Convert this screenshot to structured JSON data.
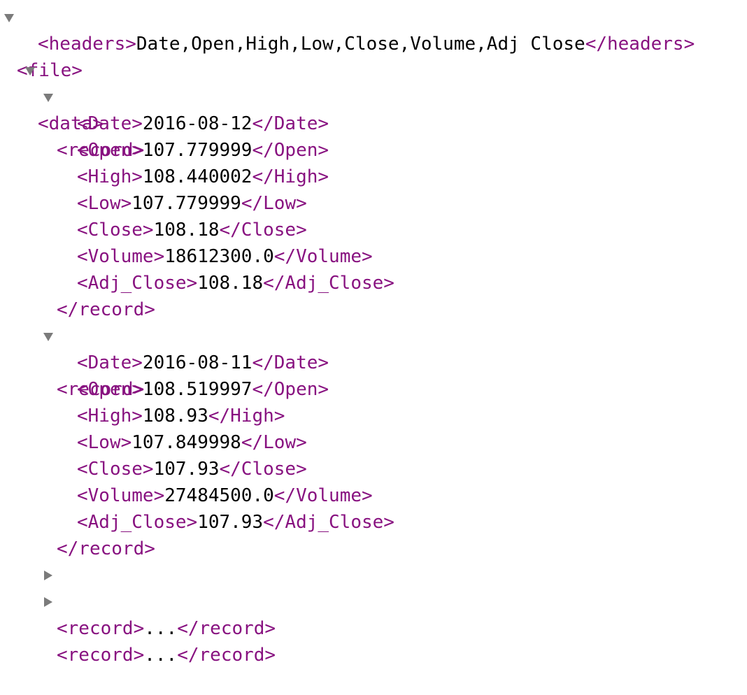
{
  "file": {
    "open_tag": "<file>",
    "headers": {
      "open_tag": "<headers>",
      "value": "Date,Open,High,Low,Close,Volume,Adj Close",
      "close_tag": "</headers>"
    },
    "data": {
      "open_tag": "<data>",
      "records": [
        {
          "open_tag": "<record>",
          "close_tag": "</record>",
          "fields": [
            {
              "open": "<Date>",
              "value": "2016-08-12",
              "close": "</Date>"
            },
            {
              "open": "<Open>",
              "value": "107.779999",
              "close": "</Open>"
            },
            {
              "open": "<High>",
              "value": "108.440002",
              "close": "</High>"
            },
            {
              "open": "<Low>",
              "value": "107.779999",
              "close": "</Low>"
            },
            {
              "open": "<Close>",
              "value": "108.18",
              "close": "</Close>"
            },
            {
              "open": "<Volume>",
              "value": "18612300.0",
              "close": "</Volume>"
            },
            {
              "open": "<Adj_Close>",
              "value": "108.18",
              "close": "</Adj_Close>"
            }
          ]
        },
        {
          "open_tag": "<record>",
          "close_tag": "</record>",
          "fields": [
            {
              "open": "<Date>",
              "value": "2016-08-11",
              "close": "</Date>"
            },
            {
              "open": "<Open>",
              "value": "108.519997",
              "close": "</Open>"
            },
            {
              "open": "<High>",
              "value": "108.93",
              "close": "</High>"
            },
            {
              "open": "<Low>",
              "value": "107.849998",
              "close": "</Low>"
            },
            {
              "open": "<Close>",
              "value": "107.93",
              "close": "</Close>"
            },
            {
              "open": "<Volume>",
              "value": "27484500.0",
              "close": "</Volume>"
            },
            {
              "open": "<Adj_Close>",
              "value": "107.93",
              "close": "</Adj_Close>"
            }
          ]
        }
      ],
      "collapsed_records": [
        {
          "open_tag": "<record>",
          "ellipsis": "...",
          "close_tag": "</record>"
        },
        {
          "open_tag": "<record>",
          "ellipsis": "...",
          "close_tag": "</record>"
        }
      ]
    }
  },
  "colors": {
    "tag": "#881280",
    "text": "#000000",
    "toggle": "#7b7b7b",
    "background": "#ffffff"
  },
  "icons": {
    "expanded": "triangle-down-icon",
    "collapsed": "triangle-right-icon"
  }
}
